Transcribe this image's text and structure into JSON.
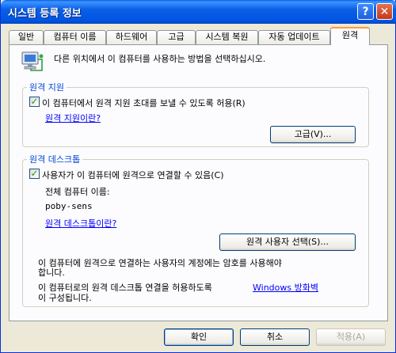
{
  "window": {
    "title": "시스템 등록 정보",
    "help_glyph": "?",
    "close_glyph": "✕"
  },
  "tabs": [
    {
      "label": "일반"
    },
    {
      "label": "컴퓨터 이름"
    },
    {
      "label": "하드웨어"
    },
    {
      "label": "고급"
    },
    {
      "label": "시스템 복원"
    },
    {
      "label": "자동 업데이트"
    },
    {
      "label": "원격"
    }
  ],
  "active_tab": "원격",
  "header": {
    "icon": "computer-network-icon",
    "text": "다른 위치에서 이 컴퓨터를 사용하는 방법을 선택하십시오."
  },
  "remote_assistance": {
    "title": "원격 지원",
    "checkbox_label": "이 컴퓨터에서 원격 지원 초대를 보낼 수 있도록 허용(R)",
    "checked": true,
    "help_link": "원격 지원이란?",
    "advanced_button": "고급(V)..."
  },
  "remote_desktop": {
    "title": "원격 데스크톱",
    "checkbox_label": "사용자가 이 컴퓨터에 원격으로 연결할 수 있음(C)",
    "checked": true,
    "full_name_label": "전체 컴퓨터 이름:",
    "computer_name": "poby-sens",
    "help_link": "원격 데스크톱이란?",
    "select_users_button": "원격 사용자 선택(S)...",
    "note1_line1": "이 컴퓨터에 원격으로 연결하는 사용자의 계정에는 암호를 사용해야",
    "note1_line2": "합니다.",
    "note2_prefix": "이 컴퓨터로의 원격 데스크톱 연결을 허용하도록",
    "note2_link": "Windows 방화벽",
    "note2_line2": "이 구성됩니다."
  },
  "footer": {
    "ok": "확인",
    "cancel": "취소",
    "apply": "적용(A)"
  },
  "colors": {
    "title_bar": "#0054e3",
    "group_title": "#0046d5",
    "link": "#0000ff",
    "check": "#21a121",
    "active_tab_accent": "#ff9b3a"
  }
}
